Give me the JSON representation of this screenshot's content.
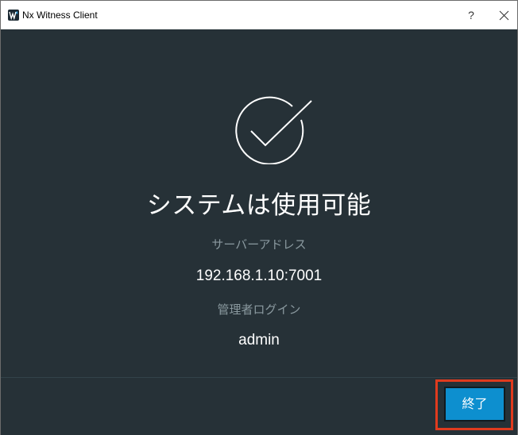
{
  "window": {
    "title": "Nx Witness Client",
    "help_label": "?",
    "icons": {
      "app": "nx-witness-logo-icon",
      "close": "close-icon"
    }
  },
  "main": {
    "success_icon": "check-circle-icon",
    "headline": "システムは使用可能",
    "server_address_label": "サーバーアドレス",
    "server_address": "192.168.1.10:7001",
    "admin_login_label": "管理者ログイン",
    "admin_login": "admin"
  },
  "footer": {
    "finish_label": "終了"
  },
  "colors": {
    "background": "#263137",
    "accent": "#0d8fcf",
    "muted_text": "#8a999f",
    "highlight_border": "#e03b1e"
  }
}
